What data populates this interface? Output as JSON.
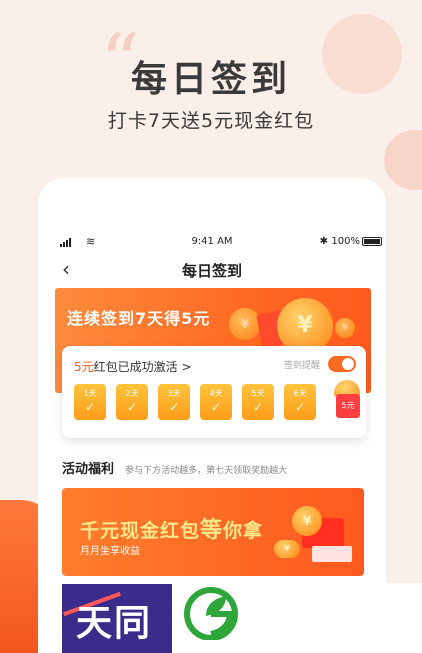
{
  "hero": {
    "quote_glyph": "“",
    "title": "每日签到",
    "subtitle": "打卡7天送5元现金红包"
  },
  "status_bar": {
    "time": "9:41 AM",
    "bluetooth": "✱",
    "battery": "100%"
  },
  "nav": {
    "back_glyph": "‹",
    "title": "每日签到"
  },
  "banner": {
    "text": "连续签到7天得5元",
    "coin_symbol": "¥"
  },
  "checkin": {
    "activated_amount": "5元",
    "activated_text": "红包已成功激活 >",
    "remind_label": "签到提醒",
    "remind_on": true,
    "days": [
      {
        "label": "1天",
        "mark": "✓"
      },
      {
        "label": "2天",
        "mark": "✓"
      },
      {
        "label": "3天",
        "mark": "✓"
      },
      {
        "label": "4天",
        "mark": "✓"
      },
      {
        "label": "5天",
        "mark": "✓"
      },
      {
        "label": "6天",
        "mark": "✓"
      }
    ],
    "gift_label": "5元"
  },
  "welfare": {
    "title": "活动福利",
    "subtitle": "参与下方活动越多，第七天领取奖励越大"
  },
  "promo": {
    "title_a": "千元现金红包",
    "title_b": "等",
    "title_c": "你拿",
    "subtitle": "月月坐享收益",
    "coin_symbol": "¥"
  },
  "bottom_card": {
    "text": "天同"
  },
  "colors": {
    "accent": "#ff6a22",
    "gold": "#ffc43d",
    "background": "#fbefe9"
  }
}
